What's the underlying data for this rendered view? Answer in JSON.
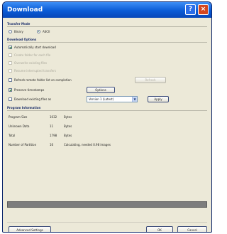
{
  "window": {
    "title": "Download",
    "help_glyph": "?",
    "close_glyph": "×"
  },
  "transfer_mode": {
    "header": "Transfer Mode",
    "options": [
      {
        "label": "Binary",
        "selected": false
      },
      {
        "label": "ASCII",
        "selected": true
      }
    ]
  },
  "download_options": {
    "header": "Download Options",
    "checkboxes": [
      {
        "label": "Automatically start download",
        "checked": true,
        "enabled": true
      },
      {
        "label": "Create folder for each file",
        "checked": false,
        "enabled": false
      },
      {
        "label": "Overwrite existing files",
        "checked": false,
        "enabled": false
      },
      {
        "label": "Resume interrupted transfers",
        "checked": false,
        "enabled": false
      }
    ],
    "refresh_row": {
      "label": "Refresh remote folder list on completion",
      "checked": false,
      "enabled": true,
      "button": "Refresh"
    },
    "timestamp_row": {
      "label": "Preserve timestamps",
      "checked": true,
      "enabled": true,
      "button": "Options"
    },
    "mode_row": {
      "label": "Download existing files as",
      "checked": false,
      "enabled": true,
      "select_value": "Version 1 (Latest)",
      "button": "Apply"
    }
  },
  "program_info": {
    "header": "Program Information",
    "rows": [
      {
        "label": "Program Size",
        "count": "1032",
        "size": "Bytes"
      },
      {
        "label": "Unknown Data",
        "count": "11",
        "size": "Bytes"
      },
      {
        "label": "Total",
        "count": "1798",
        "size": "Bytes"
      },
      {
        "label": "Number of Partition",
        "count": "16",
        "size": "Calculating, needed 0.98 images"
      }
    ]
  },
  "progress": {
    "fraction": 0.0
  },
  "footer": {
    "advanced_button": "Advanced Settings",
    "ok_button": "OK",
    "cancel_button": "Cancel"
  }
}
